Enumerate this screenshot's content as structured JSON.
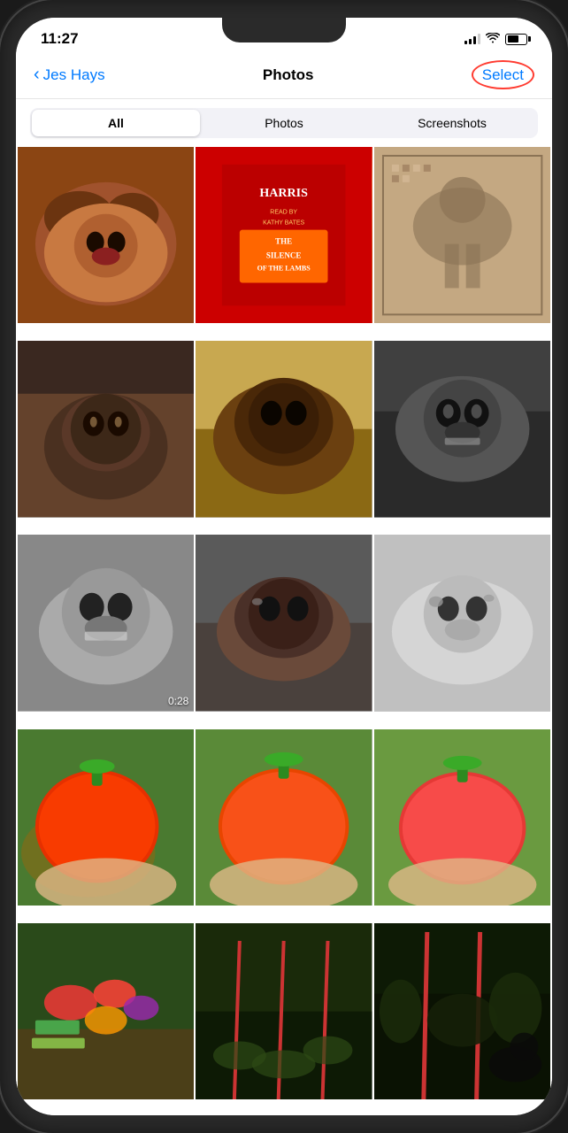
{
  "status_bar": {
    "time": "11:27",
    "battery_level": 60
  },
  "nav": {
    "back_label": "Jes Hays",
    "title": "Photos",
    "select_label": "Select"
  },
  "segments": {
    "options": [
      "All",
      "Photos",
      "Screenshots"
    ],
    "active_index": 0
  },
  "photos": [
    {
      "id": 1,
      "type": "image",
      "css_class": "dog1",
      "has_video": false,
      "duration": null
    },
    {
      "id": 2,
      "type": "image",
      "css_class": "book",
      "has_video": false,
      "duration": null
    },
    {
      "id": 3,
      "type": "image",
      "css_class": "mosaic",
      "has_video": false,
      "duration": null
    },
    {
      "id": 4,
      "type": "image",
      "css_class": "dog2",
      "has_video": false,
      "duration": null
    },
    {
      "id": 5,
      "type": "image",
      "css_class": "dog3",
      "has_video": false,
      "duration": null
    },
    {
      "id": 6,
      "type": "image",
      "css_class": "dog4",
      "has_video": false,
      "duration": null
    },
    {
      "id": 7,
      "type": "video",
      "css_class": "dog5",
      "has_video": true,
      "duration": "0:28"
    },
    {
      "id": 8,
      "type": "image",
      "css_class": "dog6",
      "has_video": false,
      "duration": null
    },
    {
      "id": 9,
      "type": "image",
      "css_class": "dog7",
      "has_video": false,
      "duration": null
    },
    {
      "id": 10,
      "type": "image",
      "css_class": "tomato1",
      "has_video": false,
      "duration": null
    },
    {
      "id": 11,
      "type": "image",
      "css_class": "tomato2",
      "has_video": false,
      "duration": null
    },
    {
      "id": 12,
      "type": "image",
      "css_class": "tomato3",
      "has_video": false,
      "duration": null
    },
    {
      "id": 13,
      "type": "image",
      "css_class": "veggies",
      "has_video": false,
      "duration": null
    },
    {
      "id": 14,
      "type": "image",
      "css_class": "garden1",
      "has_video": false,
      "duration": null
    },
    {
      "id": 15,
      "type": "image",
      "css_class": "garden2",
      "has_video": false,
      "duration": null
    }
  ],
  "icons": {
    "chevron": "‹",
    "wifi": "wifi",
    "battery": "battery"
  }
}
